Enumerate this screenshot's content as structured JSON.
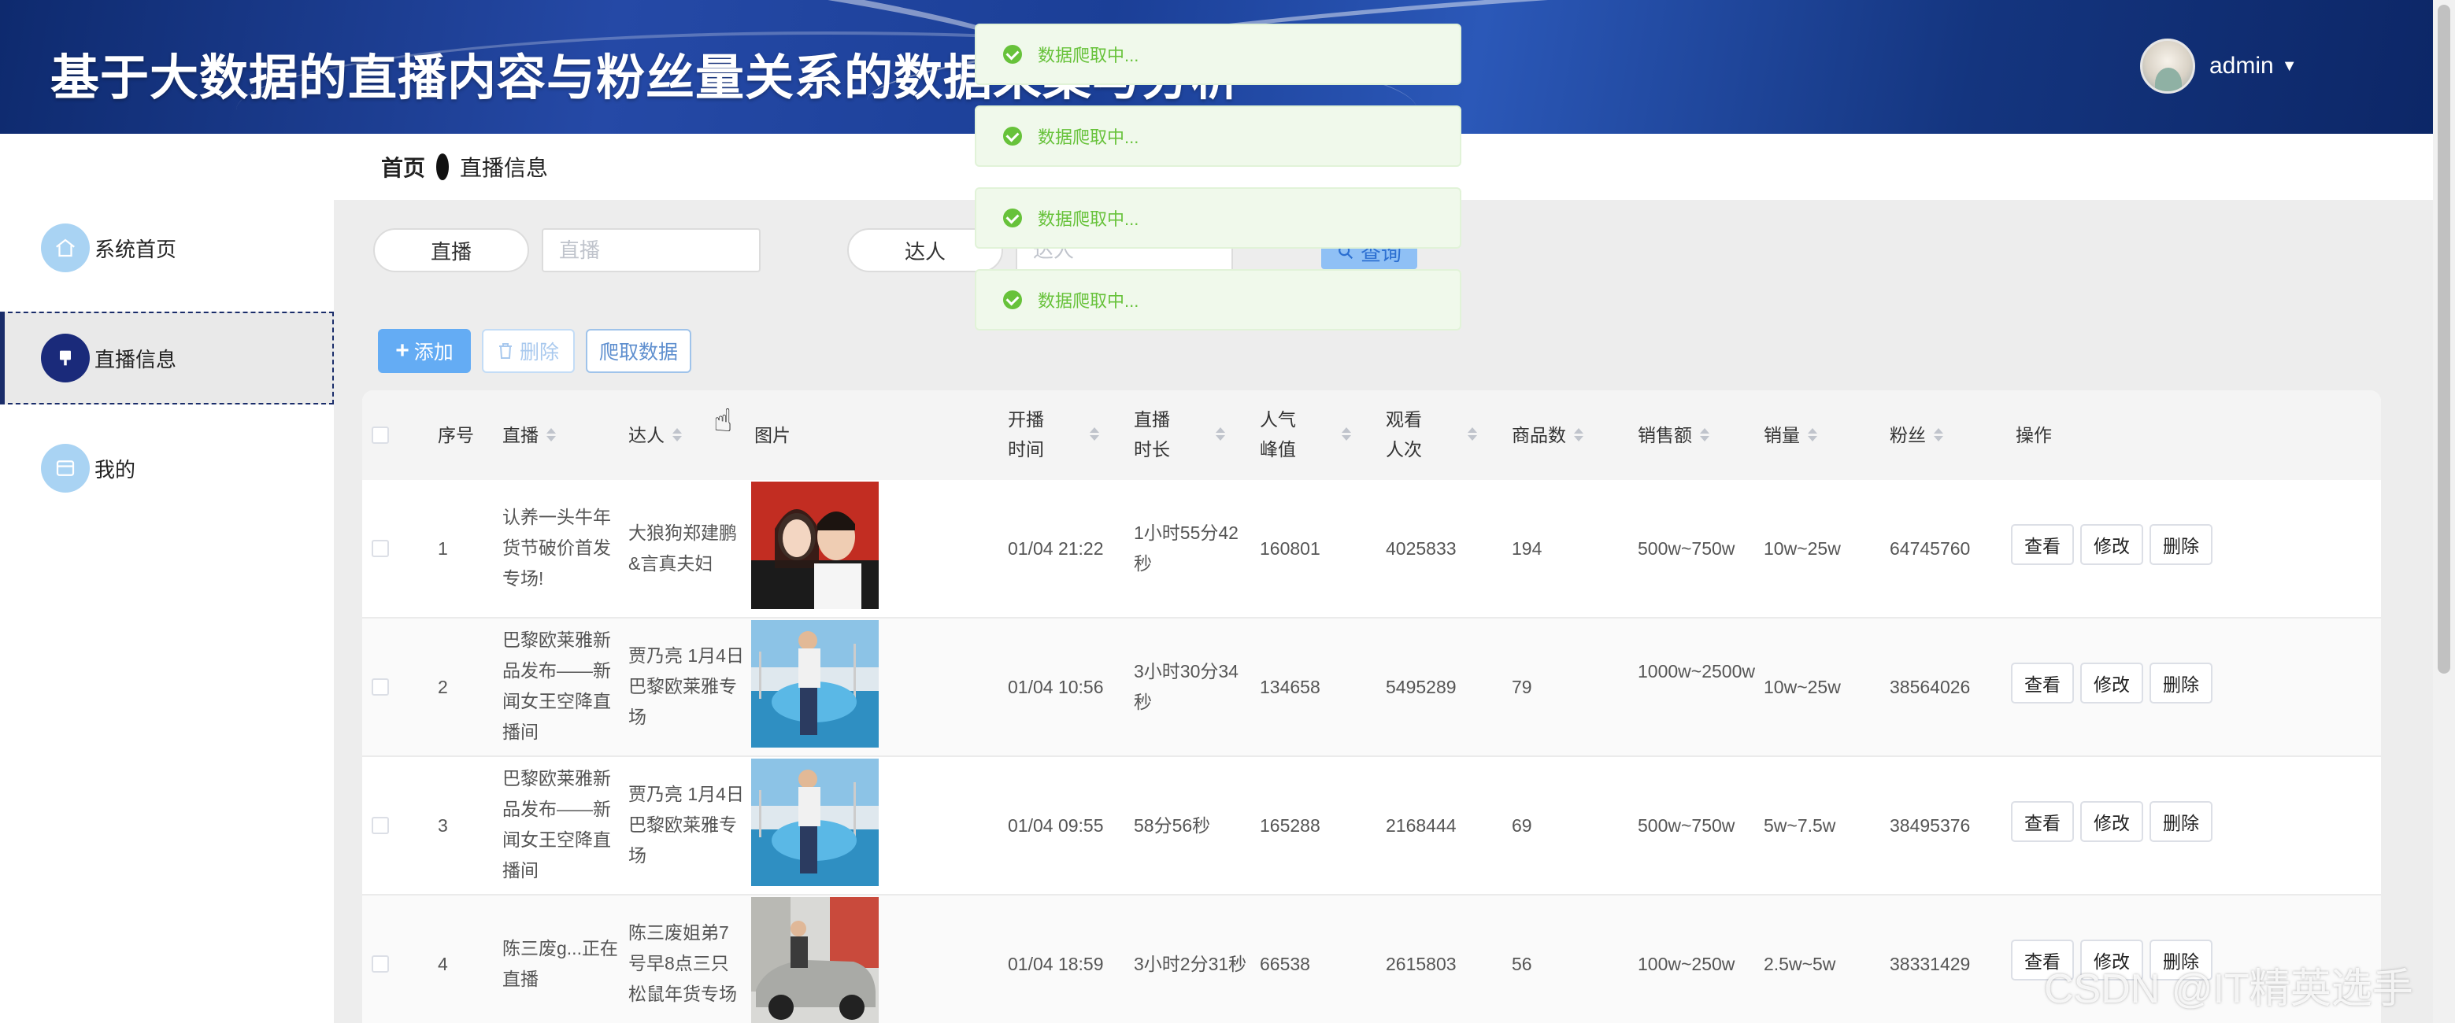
{
  "header": {
    "title": "基于大数据的直播内容与粉丝量关系的数据采集与分析",
    "username": "admin"
  },
  "sidebar": {
    "items": [
      {
        "label": "系统首页",
        "icon": "home-icon"
      },
      {
        "label": "直播信息",
        "icon": "live-icon"
      },
      {
        "label": "我的",
        "icon": "profile-icon"
      }
    ]
  },
  "breadcrumb": {
    "home": "首页",
    "current": "直播信息"
  },
  "search": {
    "field1_label": "直播",
    "field1_placeholder": "直播",
    "field2_label": "达人",
    "field2_placeholder": "达人",
    "button_label": "查询"
  },
  "toolbar": {
    "add_label": "添加",
    "delete_label": "删除",
    "crawl_label": "爬取数据"
  },
  "toasts": [
    "数据爬取中...",
    "数据爬取中...",
    "数据爬取中...",
    "数据爬取中..."
  ],
  "table": {
    "headers": {
      "index": "序号",
      "live": "直播",
      "streamer": "达人",
      "image": "图片",
      "start_time": "开播时间",
      "duration": "直播时长",
      "peak": "人气峰值",
      "viewers": "观看人次",
      "goods": "商品数",
      "sales_amount": "销售额",
      "sales_volume": "销量",
      "fans": "粉丝",
      "actions": "操作"
    },
    "actions": {
      "view": "查看",
      "edit": "修改",
      "delete": "删除"
    },
    "rows": [
      {
        "index": "1",
        "live": "认养一头牛年货节破价首发专场!",
        "streamer": "大狼狗郑建鹏&言真夫妇",
        "start_time": "01/04 21:22",
        "duration": "1小时55分42秒",
        "peak": "160801",
        "viewers": "4025833",
        "goods": "194",
        "sales_amount": "500w~750w",
        "sales_volume": "10w~25w",
        "fans": "64745760"
      },
      {
        "index": "2",
        "live": "巴黎欧莱雅新品发布——新闻女王空降直播间",
        "streamer": "贾乃亮 1月4日巴黎欧莱雅专场",
        "start_time": "01/04 10:56",
        "duration": "3小时30分34秒",
        "peak": "134658",
        "viewers": "5495289",
        "goods": "79",
        "sales_amount": "1000w~2500w",
        "sales_volume": "10w~25w",
        "fans": "38564026"
      },
      {
        "index": "3",
        "live": "巴黎欧莱雅新品发布——新闻女王空降直播间",
        "streamer": "贾乃亮 1月4日巴黎欧莱雅专场",
        "start_time": "01/04 09:55",
        "duration": "58分56秒",
        "peak": "165288",
        "viewers": "2168444",
        "goods": "69",
        "sales_amount": "500w~750w",
        "sales_volume": "5w~7.5w",
        "fans": "38495376"
      },
      {
        "index": "4",
        "live": "陈三废g...正在直播",
        "streamer": "陈三废姐弟7号早8点三只松鼠年货专场",
        "start_time": "01/04 18:59",
        "duration": "3小时2分31秒",
        "peak": "66538",
        "viewers": "2615803",
        "goods": "56",
        "sales_amount": "100w~250w",
        "sales_volume": "2.5w~5w",
        "fans": "38331429"
      }
    ]
  },
  "watermark": "CSDN @IT精英选手",
  "colors": {
    "primary": "#64acf4",
    "header_dark": "#0e2a6e",
    "success": "#67c23a",
    "nav_active": "#1a2d6a"
  }
}
